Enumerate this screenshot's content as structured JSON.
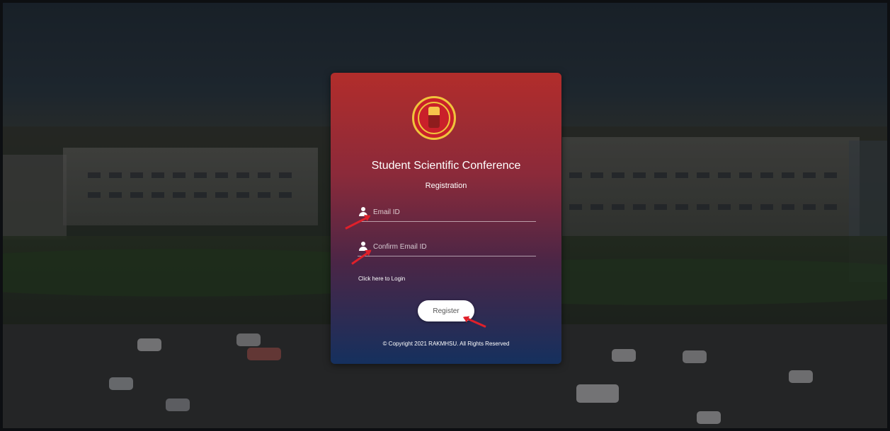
{
  "header": {
    "title": "Student Scientific Conference",
    "subtitle": "Registration"
  },
  "form": {
    "email_placeholder": "Email ID",
    "confirm_email_placeholder": "Confirm Email ID",
    "email_value": "",
    "confirm_email_value": ""
  },
  "links": {
    "login": "Click here to Login"
  },
  "buttons": {
    "register": "Register"
  },
  "footer": {
    "copyright": "© Copyright 2021 RAKMHSU. All Rights Reserved"
  },
  "icons": {
    "user": "user-icon",
    "logo": "university-logo"
  },
  "colors": {
    "card_top": "#b22d2b",
    "card_bottom": "#15305e",
    "annotation_arrow": "#e0202a",
    "button_bg": "#ffffff"
  }
}
